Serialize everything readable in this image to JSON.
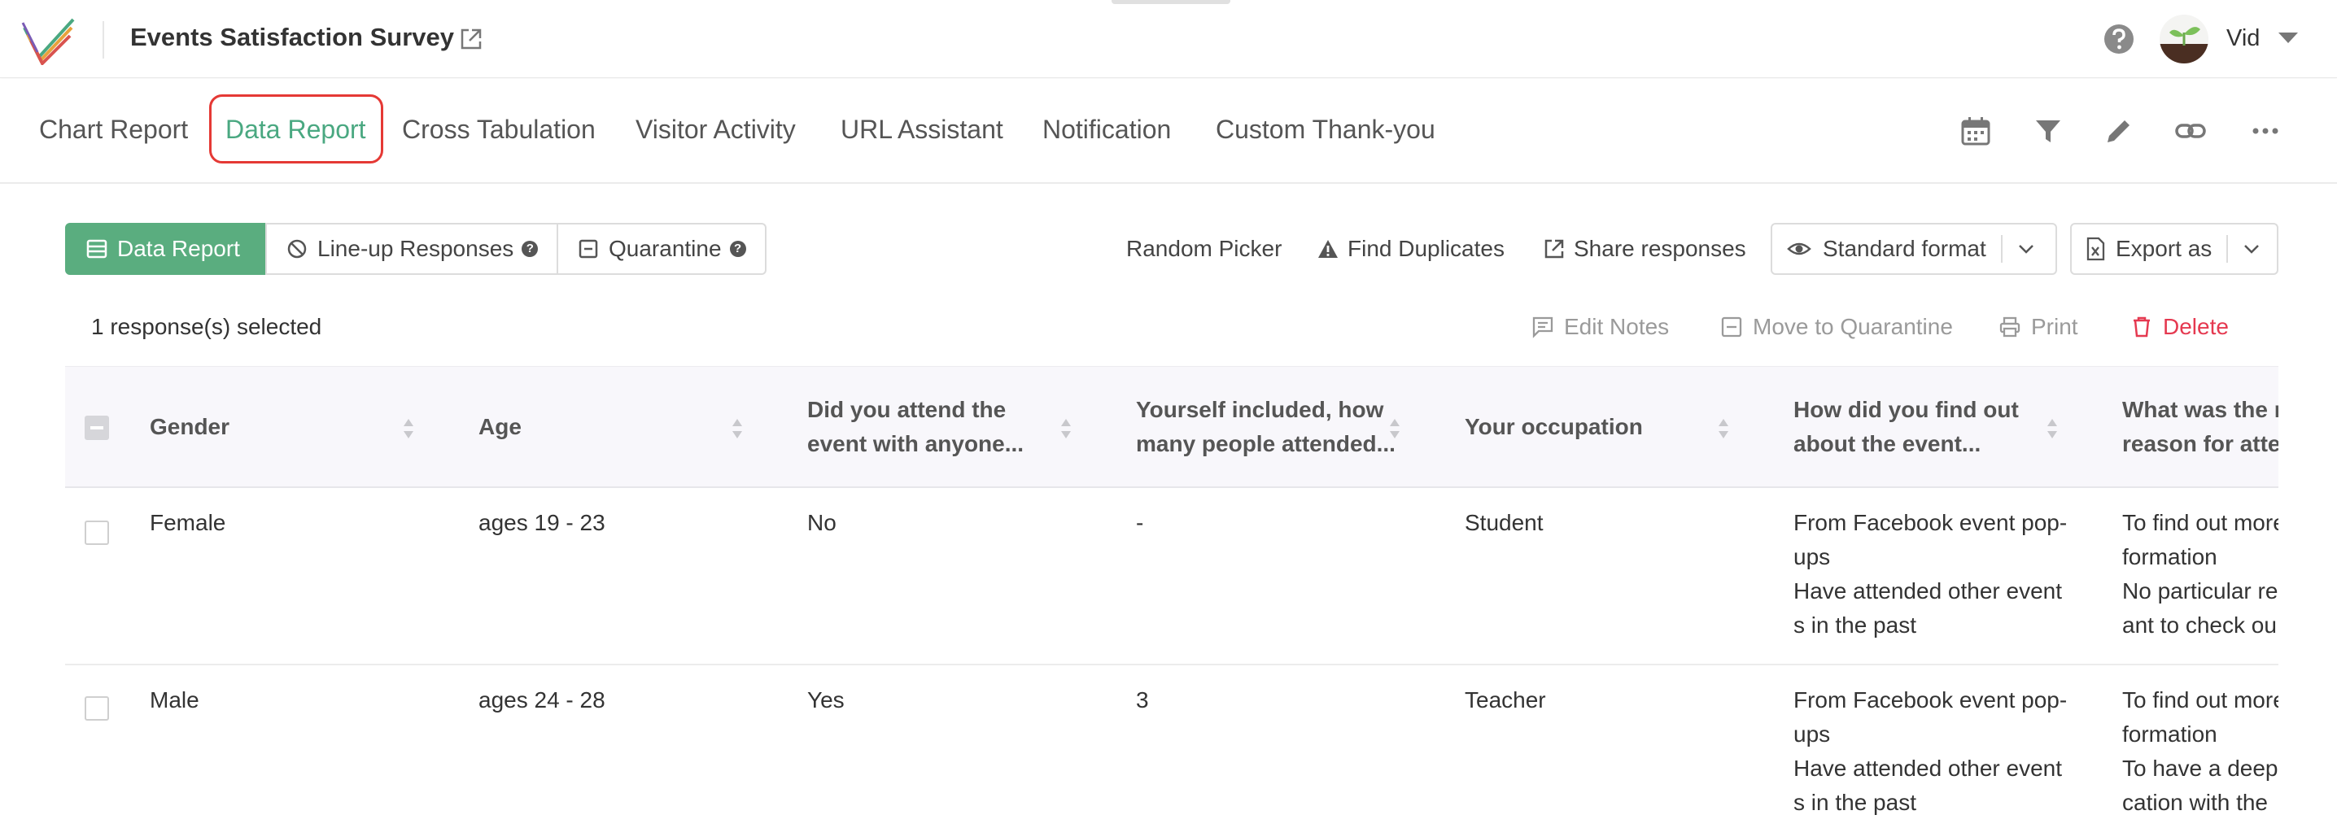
{
  "header": {
    "survey_title": "Events Satisfaction Survey",
    "user_name": "Vid"
  },
  "nav": {
    "tabs": [
      "Chart Report",
      "Data Report",
      "Cross Tabulation",
      "Visitor Activity",
      "URL Assistant",
      "Notification",
      "Custom Thank-you"
    ],
    "active_tab": "Data Report"
  },
  "toolbar": {
    "data_report": "Data Report",
    "lineup_responses": "Line-up Responses",
    "quarantine": "Quarantine",
    "random_picker": "Random Picker",
    "find_duplicates": "Find Duplicates",
    "share_responses": "Share responses",
    "standard_format": "Standard format",
    "export_as": "Export as"
  },
  "selection": {
    "count_text": "1 response(s) selected",
    "edit_notes": "Edit Notes",
    "move_to_quarantine": "Move to Quarantine",
    "print": "Print",
    "delete": "Delete"
  },
  "table": {
    "columns": [
      [
        "Gender"
      ],
      [
        "Age"
      ],
      [
        "Did you attend the",
        "event with anyone..."
      ],
      [
        "Yourself included, how",
        "many people attended..."
      ],
      [
        "Your occupation"
      ],
      [
        "How did you find out",
        "about the event..."
      ],
      [
        "What was the m",
        "reason for atter"
      ]
    ],
    "rows": [
      {
        "gender": "Female",
        "age": "ages 19 - 23",
        "attend_with_anyone": "No",
        "people_attended": "-",
        "occupation": "Student",
        "find_out": [
          "From Facebook event pop-",
          "ups",
          "Have attended other event",
          "s in the past"
        ],
        "reason": [
          "To find out more",
          "formation",
          "No particular re",
          "ant to check ou"
        ]
      },
      {
        "gender": "Male",
        "age": "ages 24 - 28",
        "attend_with_anyone": "Yes",
        "people_attended": "3",
        "occupation": "Teacher",
        "find_out": [
          "From Facebook event pop-",
          "ups",
          "Have attended other event",
          "s in the past"
        ],
        "reason": [
          "To find out more",
          "formation",
          "To have a deepe",
          "cation with the"
        ]
      }
    ]
  },
  "colors": {
    "accent": "#4aa881",
    "active_button": "#5aad7f",
    "delete": "#e53950",
    "highlight_box": "#e53935"
  }
}
